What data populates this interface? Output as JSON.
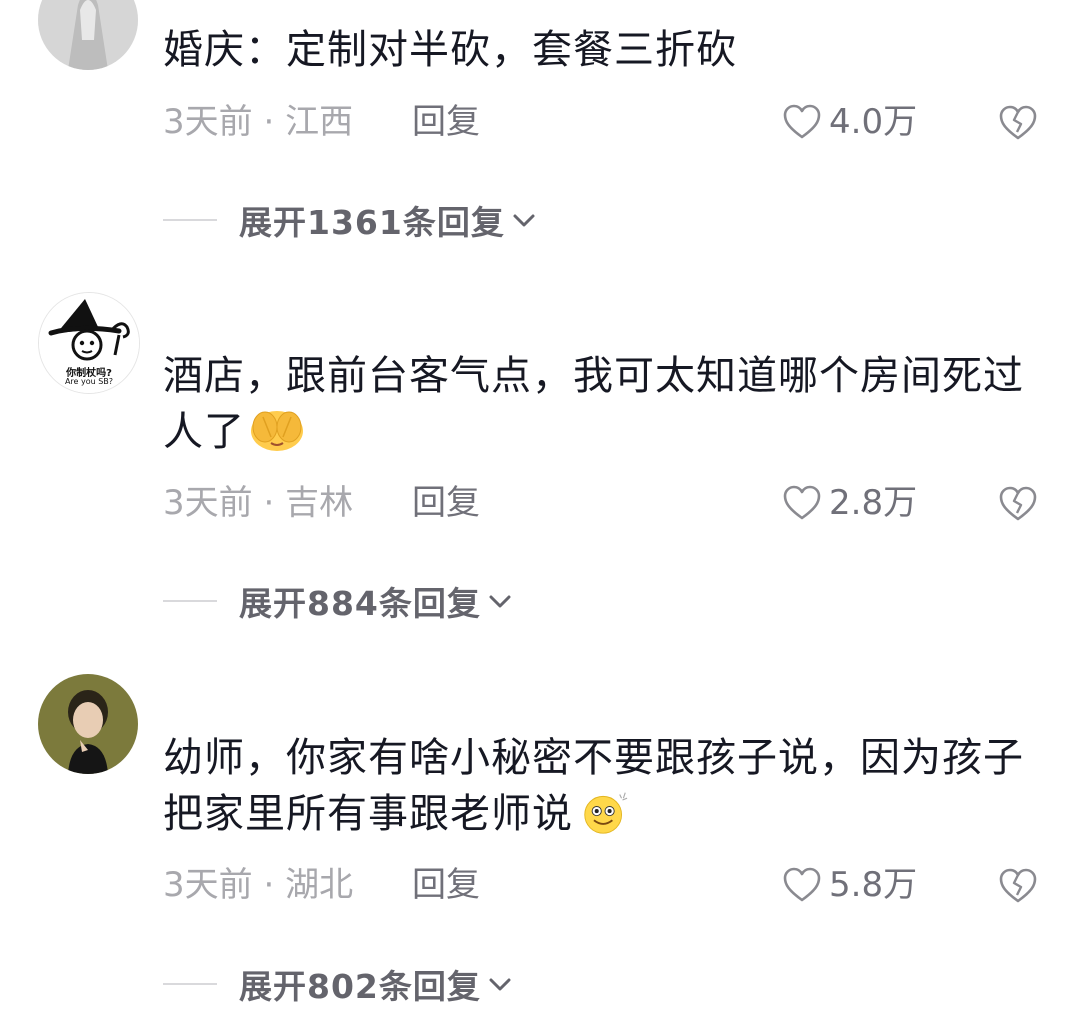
{
  "comments": [
    {
      "text": "婚庆：定制对半砍，套餐三折砍",
      "time": "3天前",
      "location": "江西",
      "reply_label": "回复",
      "likes": "4.0万",
      "expand_label": "展开1361条回复"
    },
    {
      "text": "酒店，跟前台客气点，我可太知道哪个房间死过人了",
      "avatar_text_line1": "你制杖吗?",
      "avatar_text_line2": "Are you SB?",
      "time": "3天前",
      "location": "吉林",
      "reply_label": "回复",
      "likes": "2.8万",
      "expand_label": "展开884条回复",
      "emoji": "covering-face-emoji"
    },
    {
      "text": "幼师，你家有啥小秘密不要跟孩子说，因为孩子把家里所有事跟老师说",
      "time": "3天前",
      "location": "湖北",
      "reply_label": "回复",
      "likes": "5.8万",
      "expand_label": "展开802条回复",
      "emoji": "smiling-face-emoji"
    }
  ],
  "separator": " · ",
  "colors": {
    "text": "#161823",
    "meta": "#a8a8ad",
    "action": "#707079",
    "expand": "#64646c"
  }
}
